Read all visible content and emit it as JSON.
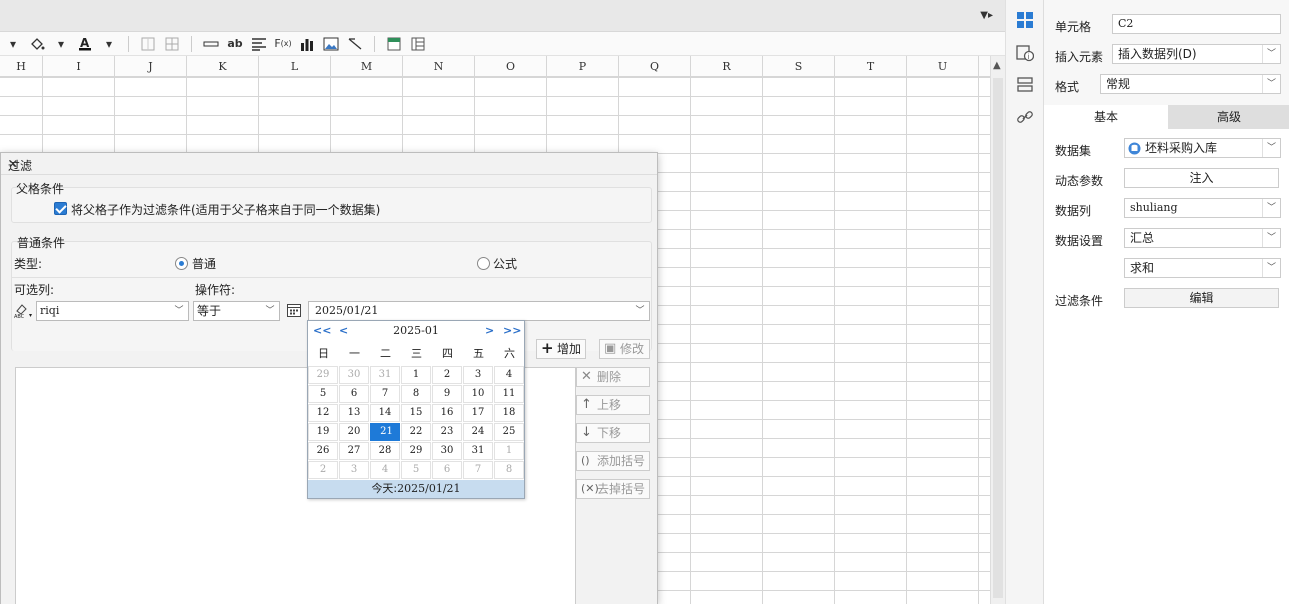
{
  "columns": [
    "H",
    "I",
    "J",
    "K",
    "L",
    "M",
    "N",
    "O",
    "P",
    "Q",
    "R",
    "S",
    "T",
    "U"
  ],
  "props": {
    "cell_label": "单元格",
    "cell_value": "C2",
    "insert_label": "插入元素",
    "insert_value": "插入数据列(D)",
    "format_label": "格式",
    "format_value": "常规",
    "tab_basic": "基本",
    "tab_advanced": "高级",
    "dataset_label": "数据集",
    "dataset_value": "坯料采购入库",
    "dynparam_label": "动态参数",
    "dynparam_btn": "注入",
    "datacol_label": "数据列",
    "datacol_value": "shuliang",
    "dataset_setting_label": "数据设置",
    "dataset_setting_value": "汇总",
    "agg_value": "求和",
    "filter_label": "过滤条件",
    "filter_btn": "编辑"
  },
  "dialog": {
    "title": "过滤",
    "parent_group": "父格条件",
    "parent_check": "将父格子作为过滤条件(适用于父子格来自于同一个数据集)",
    "normal_group": "普通条件",
    "type_label": "类型:",
    "radio_normal": "普通",
    "radio_formula": "公式",
    "col_label": "可选列:",
    "op_label": "操作符:",
    "col_value": "riqi",
    "op_value": "等于",
    "date_value": "2025/01/21",
    "btn_add": "增加",
    "btn_modify": "修改",
    "btn_delete": "删除",
    "btn_up": "上移",
    "btn_down": "下移",
    "btn_add_paren": "添加括号",
    "btn_remove_paren": "去掉括号"
  },
  "calendar": {
    "prev_year": "<<",
    "prev_month": "<",
    "next_month": ">",
    "next_year": ">>",
    "month": "2025-01",
    "weekdays": [
      "日",
      "一",
      "二",
      "三",
      "四",
      "五",
      "六"
    ],
    "days": [
      [
        "29",
        "30",
        "31",
        "1",
        "2",
        "3",
        "4"
      ],
      [
        "5",
        "6",
        "7",
        "8",
        "9",
        "10",
        "11"
      ],
      [
        "12",
        "13",
        "14",
        "15",
        "16",
        "17",
        "18"
      ],
      [
        "19",
        "20",
        "21",
        "22",
        "23",
        "24",
        "25"
      ],
      [
        "26",
        "27",
        "28",
        "29",
        "30",
        "31",
        "1"
      ],
      [
        "2",
        "3",
        "4",
        "5",
        "6",
        "7",
        "8"
      ]
    ],
    "selected": "21",
    "today_label": "今天:",
    "today_value": "2025/01/21"
  },
  "colors": {
    "accent": "#1e7ad8",
    "today_bar": "#c7dcef"
  }
}
